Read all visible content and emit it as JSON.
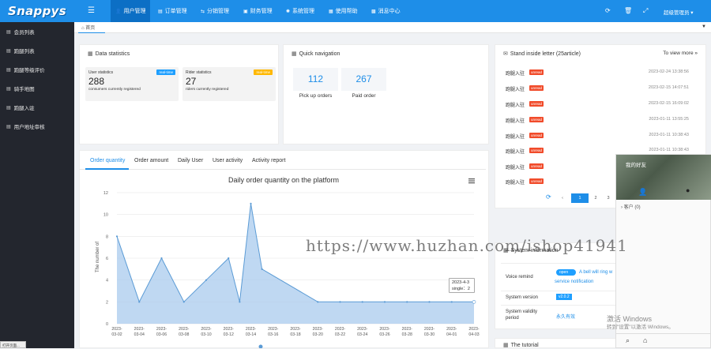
{
  "app": {
    "logo_text": "Snappys"
  },
  "topnav": {
    "items": [
      {
        "label": "用户管理",
        "icon": "user-icon"
      },
      {
        "label": "订单管理",
        "icon": "list-icon"
      },
      {
        "label": "分销管理",
        "icon": "share-icon"
      },
      {
        "label": "财务管理",
        "icon": "wallet-icon"
      },
      {
        "label": "系统管理",
        "icon": "gear-icon"
      },
      {
        "label": "使用帮助",
        "icon": "help-icon"
      },
      {
        "label": "消息中心",
        "icon": "message-icon"
      }
    ],
    "user": "超级管理员 ▾"
  },
  "sidebar": {
    "items": [
      {
        "label": "会员列表"
      },
      {
        "label": "跑腿列表"
      },
      {
        "label": "跑腿等级评价"
      },
      {
        "label": "骑手地图"
      },
      {
        "label": "跑腿入驻"
      },
      {
        "label": "用户地址审核"
      }
    ]
  },
  "tabs": {
    "home": "首页"
  },
  "data_statistics": {
    "title": "Data statistics",
    "user": {
      "label": "User statistics",
      "value": "288",
      "sub": "consumers currently registered",
      "tag": "real-time",
      "tag_color": "#1e9fff"
    },
    "rider": {
      "label": "Rider statistics",
      "value": "27",
      "sub": "riders currently registered",
      "tag": "real-time",
      "tag_color": "#ffb800"
    }
  },
  "quick_navigation": {
    "title": "Quick navigation",
    "items": [
      {
        "value": "112",
        "label": "Pick up orders"
      },
      {
        "value": "267",
        "label": "Paid order"
      }
    ]
  },
  "inside_letter": {
    "title": "Stand inside letter (25article)",
    "more": "To view more »",
    "rows": [
      {
        "title": "跑腿入驻",
        "badge": "unread",
        "date": "2023-02-24 13:38:56"
      },
      {
        "title": "跑腿入驻",
        "badge": "unread",
        "date": "2023-02-15 14:07:51"
      },
      {
        "title": "跑腿入驻",
        "badge": "unread",
        "date": "2023-02-15 16:09:02"
      },
      {
        "title": "跑腿入驻",
        "badge": "unread",
        "date": "2023-01-11 13:55:25"
      },
      {
        "title": "跑腿入驻",
        "badge": "unread",
        "date": "2023-01-11 10:38:43"
      },
      {
        "title": "跑腿入驻",
        "badge": "unread",
        "date": "2023-01-11 10:38:43"
      },
      {
        "title": "跑腿入驻",
        "badge": "unread",
        "date": ""
      },
      {
        "title": "跑腿入驻",
        "badge": "unread",
        "date": ""
      }
    ],
    "pager": [
      "‹",
      "1",
      "2",
      "3"
    ]
  },
  "chart_tabs": [
    "Order quantity",
    "Order amount",
    "Daily User",
    "User activity",
    "Activity report"
  ],
  "chart_data": {
    "type": "area",
    "title": "Daily order quantity on the platform",
    "ylabel": "The number of",
    "ylim": [
      0,
      12
    ],
    "yticks": [
      0,
      2,
      4,
      6,
      8,
      10,
      12
    ],
    "categories": [
      "2023-03-02",
      "2023-03-04",
      "2023-03-06",
      "2023-03-08",
      "2023-03-10",
      "2023-03-12",
      "2023-03-14",
      "2023-03-16",
      "2023-03-18",
      "2023-03-20",
      "2023-03-22",
      "2023-03-24",
      "2023-03-26",
      "2023-03-28",
      "2023-03-30",
      "2023-04-01",
      "2023-04-03"
    ],
    "x": [
      "2023-03-02",
      "2023-03-04",
      "2023-03-06",
      "2023-03-08",
      "2023-03-10",
      "2023-03-12",
      "2023-03-13",
      "2023-03-14",
      "2023-03-15",
      "2023-03-20",
      "2023-03-22",
      "2023-03-24",
      "2023-03-26",
      "2023-03-28",
      "2023-03-30",
      "2023-04-01",
      "2023-04-03"
    ],
    "values": [
      8,
      2,
      6,
      2,
      4,
      6,
      2,
      11,
      5,
      2,
      2,
      2,
      2,
      2,
      2,
      2,
      2
    ],
    "series_name": "Daily order quantity",
    "color": "#5b9bd5",
    "tooltip": {
      "date": "2023-4-3",
      "text": "single：2"
    }
  },
  "system_info": {
    "title": "System information",
    "rows": [
      {
        "key": "Voice remind",
        "toggle": "open",
        "text": "A bell will ring w",
        "link": "service notification"
      },
      {
        "key": "System version",
        "value": "v2.0.2"
      },
      {
        "key": "System validity period",
        "value": "永久有效"
      }
    ]
  },
  "tutorial": {
    "title": "The tutorial"
  },
  "qq": {
    "title": "我的好友",
    "group": "客户 (0)"
  },
  "watermark": "https://www.huzhan.com/ishop41941",
  "windows": {
    "line1": "激活 Windows",
    "line2": "转到\"设置\"以激活 Windows。"
  },
  "taskbar_tip": "打开页面..."
}
